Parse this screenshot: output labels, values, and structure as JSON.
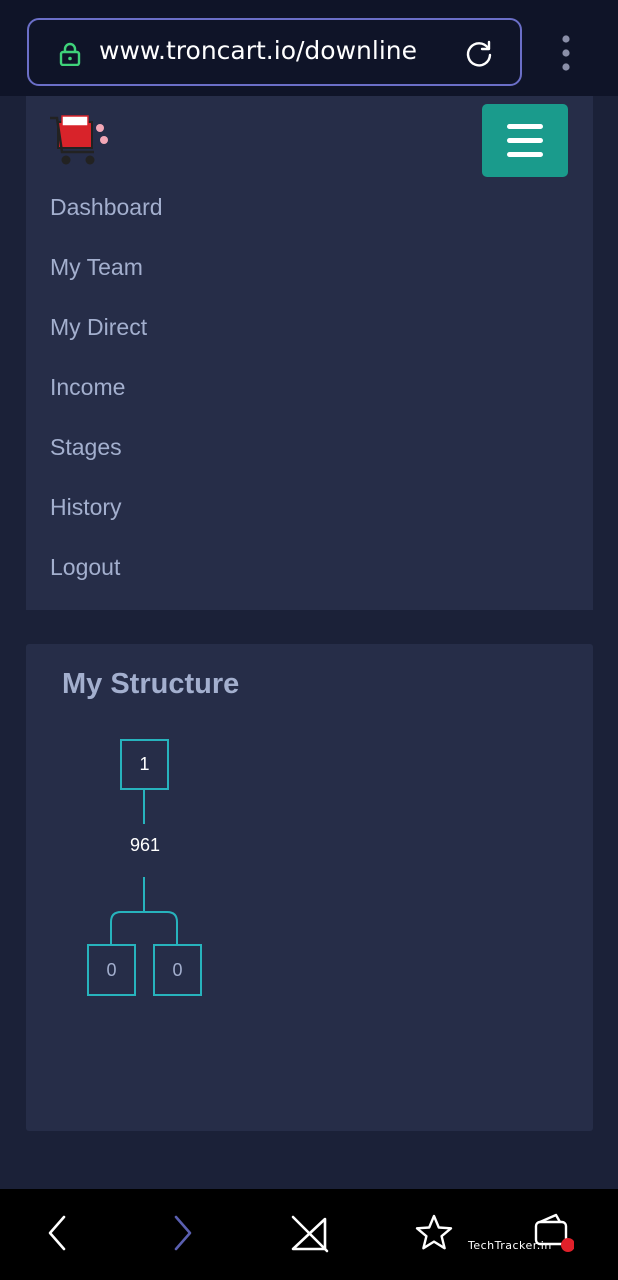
{
  "browser": {
    "url": "www.troncart.io/downline",
    "lock_icon": "lock-icon",
    "reload_icon": "reload-icon",
    "menu_icon": "kebab-menu-icon"
  },
  "nav": {
    "logo_icon": "shopping-cart-logo-icon",
    "toggle_icon": "hamburger-icon",
    "toggle_color": "#1a9b8c",
    "items": [
      {
        "label": "Dashboard"
      },
      {
        "label": "My Team"
      },
      {
        "label": "My Direct"
      },
      {
        "label": "Income"
      },
      {
        "label": "Stages"
      },
      {
        "label": "History"
      },
      {
        "label": "Logout"
      }
    ]
  },
  "structure": {
    "title": "My Structure",
    "root": {
      "value": "1",
      "count": "961"
    },
    "children": [
      {
        "value": "0"
      },
      {
        "value": "0"
      }
    ],
    "line_color": "#27b3bd"
  },
  "bottom_nav": {
    "back_icon": "back-arrow-icon",
    "forward_icon": "forward-arrow-icon",
    "no-signal_icon": "signal-off-icon",
    "bookmark_icon": "star-icon",
    "wallet_icon": "wallet-icon",
    "watermark": "TechTracker.in"
  },
  "colors": {
    "page_bg": "#1b2138",
    "panel_bg": "#262d48",
    "text_muted": "#a3afce",
    "accent": "#27b3bd"
  }
}
